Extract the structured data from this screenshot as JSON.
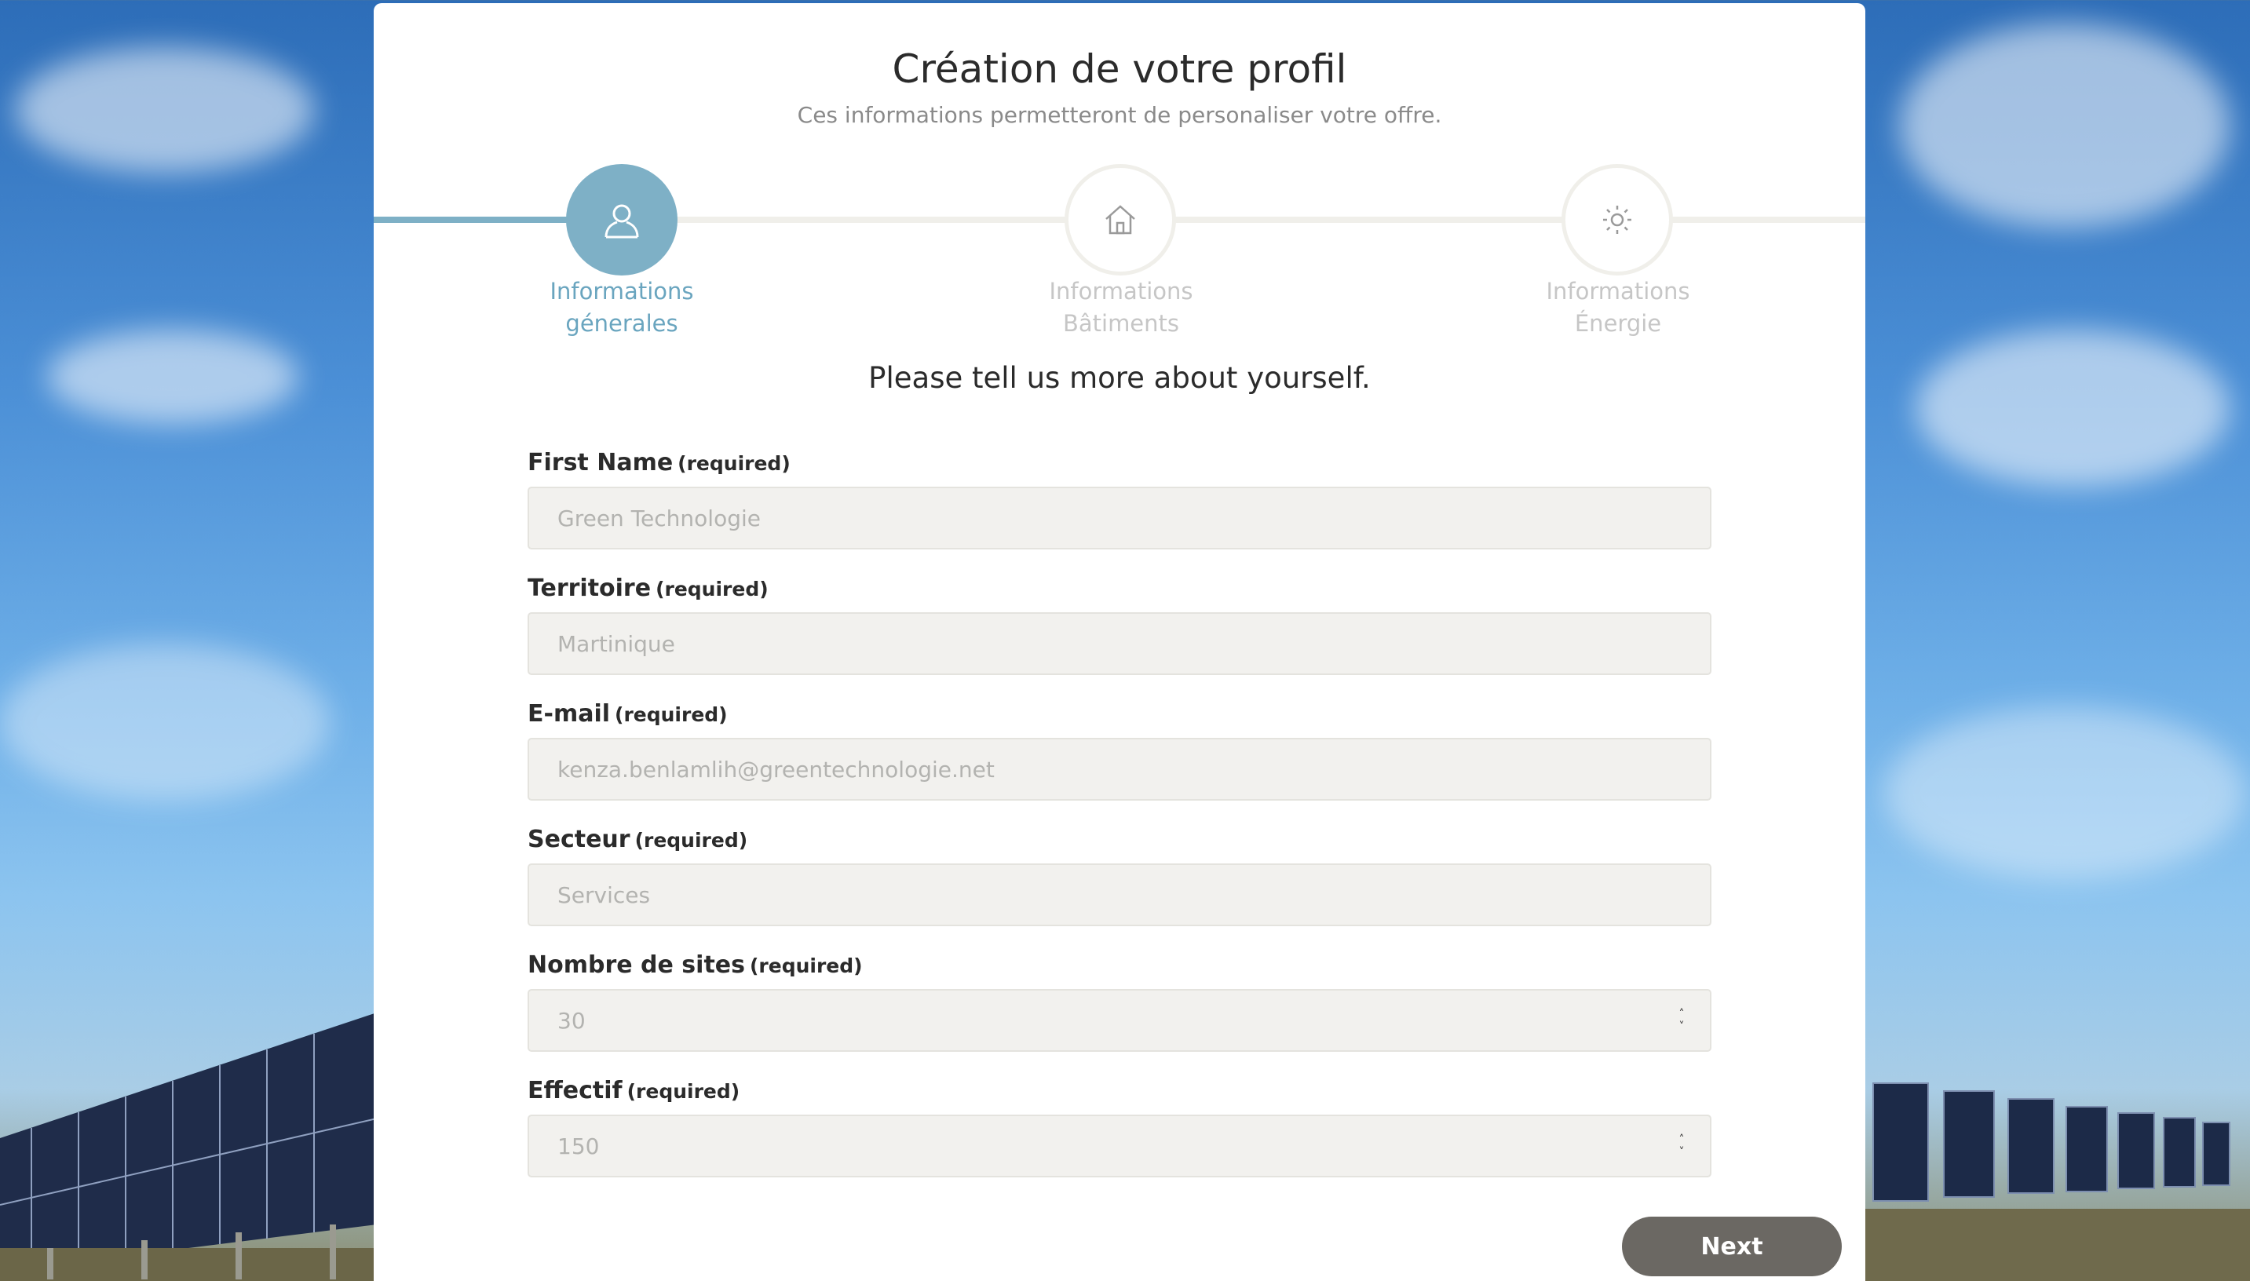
{
  "header": {
    "title": "Création de votre profil",
    "subtitle": "Ces informations permetteront de personaliser votre offre."
  },
  "steps": [
    {
      "line1": "Informations",
      "line2": "génerales",
      "icon": "user-icon",
      "state": "active"
    },
    {
      "line1": "Informations",
      "line2": "Bâtiments",
      "icon": "home-icon",
      "state": "idle"
    },
    {
      "line1": "Informations",
      "line2": "Énergie",
      "icon": "sun-icon",
      "state": "idle"
    }
  ],
  "prompt": "Please tell us more about yourself.",
  "required_tag": "(required)",
  "fields": [
    {
      "label": "First Name",
      "value": "Green Technologie"
    },
    {
      "label": "Territoire",
      "value": "Martinique"
    },
    {
      "label": "E-mail",
      "value": "kenza.benlamlih@greentechnologie.net"
    },
    {
      "label": "Secteur",
      "value": "Services"
    },
    {
      "label": "Nombre de sites",
      "value": "30"
    },
    {
      "label": "Effectif",
      "value": "150"
    }
  ],
  "next_label": "Next",
  "colors": {
    "accent": "#7eb0c6",
    "button": "#6b6863",
    "input_bg": "#f2f1ee"
  }
}
